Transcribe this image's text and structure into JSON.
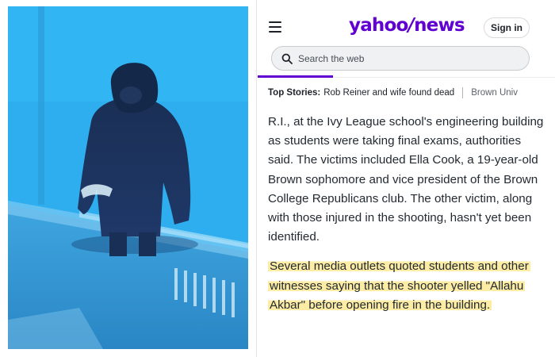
{
  "photo": {
    "description_icon": "surveillance-photo"
  },
  "app": {
    "menu_icon": "hamburger-menu-icon",
    "logo_text_1": "yahoo",
    "logo_slash": "/",
    "logo_text_2": "news",
    "signin_label": "Sign in",
    "brand_color": "#6001d2"
  },
  "search": {
    "placeholder": "Search the web",
    "icon": "search-icon"
  },
  "stories": {
    "label": "Top Stories:",
    "items": [
      "Rob Reiner and wife found dead",
      "Brown Univ"
    ]
  },
  "article": {
    "paragraph_1": "R.I., at the Ivy League school's engineering building as students were taking final exams, authorities said. The victims included Ella Cook, a 19-year-old Brown sophomore and vice president of the Brown College Republicans club. The other victim, along with those injured in the shooting, hasn't yet been identified.",
    "paragraph_2": "Several media outlets quoted students and other witnesses saying that the shooter yelled \"Allahu Akbar\" before opening fire in the building.",
    "highlight_color": "#fce894"
  }
}
